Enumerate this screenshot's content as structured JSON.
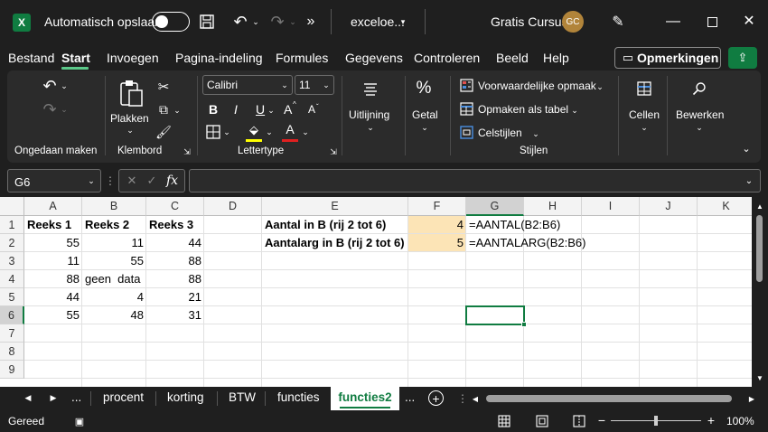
{
  "title_bar": {
    "app_icon": "excel-icon",
    "autosave_label": "Automatisch opslaan",
    "filename": "exceloe...",
    "user_label": "Gratis Cursus",
    "avatar_initials": "GC"
  },
  "menu_tabs": [
    "Bestand",
    "Start",
    "Invoegen",
    "Pagina-indeling",
    "Formules",
    "Gegevens",
    "Controleren",
    "Beeld",
    "Help"
  ],
  "active_tab": "Start",
  "comments_button": "Opmerkingen",
  "ribbon": {
    "undo_group": "Ongedaan maken",
    "clipboard_group": "Klembord",
    "paste_label": "Plakken",
    "font_group": "Lettertype",
    "font_name": "Calibri",
    "font_size": "11",
    "bold": "B",
    "italic": "I",
    "underline": "U",
    "grow_font": "A",
    "shrink_font": "A",
    "alignment_label": "Uitlijning",
    "number_label": "Getal",
    "styles_group": "Stijlen",
    "conditional_formatting": "Voorwaardelijke opmaak",
    "format_as_table": "Opmaken als tabel",
    "cell_styles": "Celstijlen",
    "cells_label": "Cellen",
    "editing_label": "Bewerken"
  },
  "formula_bar": {
    "name_box": "G6",
    "fx": "fx",
    "formula": ""
  },
  "grid": {
    "columns": [
      "A",
      "B",
      "C",
      "D",
      "E",
      "F",
      "G",
      "H",
      "I",
      "J",
      "K"
    ],
    "rows": [
      "1",
      "2",
      "3",
      "4",
      "5",
      "6",
      "7",
      "8",
      "9"
    ],
    "cells": {
      "A1": "Reeks 1",
      "B1": "Reeks 2",
      "C1": "Reeks 3",
      "E1": "Aantal in B (rij 2 tot 6)",
      "F1": "4",
      "G1": "=AANTAL(B2:B6)",
      "A2": "55",
      "B2": "11",
      "C2": "44",
      "E2": "Aantalarg in B (rij 2 tot 6)",
      "F2": "5",
      "G2": "=AANTALARG(B2:B6)",
      "A3": "11",
      "B3": "55",
      "C3": "88",
      "A4": "88",
      "B4": "geen  data",
      "C4": "88",
      "A5": "44",
      "B5": "4",
      "C5": "21",
      "A6": "55",
      "B6": "48",
      "C6": "31"
    },
    "active_cell": "G6",
    "highlight_color": "#fce4b6"
  },
  "sheet_tabs": [
    "procent",
    "korting",
    "BTW",
    "functies",
    "functies2"
  ],
  "active_sheet": "functies2",
  "sheet_more": "...",
  "status": {
    "ready": "Gereed",
    "zoom": "100%"
  },
  "colors": {
    "accent_green": "#107c41",
    "tab_green": "#5cc98a"
  }
}
